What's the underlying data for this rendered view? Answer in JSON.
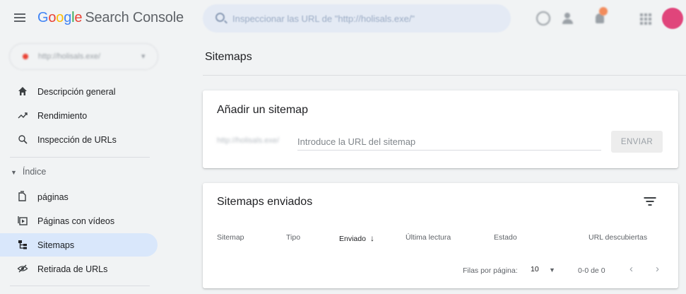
{
  "header": {
    "logo": [
      "G",
      "o",
      "o",
      "g",
      "l",
      "e"
    ],
    "product": "Search Console",
    "search_placeholder": "Inspeccionar las URL de \"http://holisals.exe/\""
  },
  "sidebar": {
    "property": "http://holisals.exe/",
    "items": [
      {
        "label": "Descripción general",
        "icon": "home-icon"
      },
      {
        "label": "Rendimiento",
        "icon": "trending-icon"
      },
      {
        "label": "Inspección de URLs",
        "icon": "search-icon"
      }
    ],
    "section": "Índice",
    "index_items": [
      {
        "label": "páginas",
        "icon": "pages-icon"
      },
      {
        "label": "Páginas con vídeos",
        "icon": "video-pages-icon"
      },
      {
        "label": "Sitemaps",
        "icon": "sitemap-icon",
        "active": true
      },
      {
        "label": "Retirada de URLs",
        "icon": "removals-icon"
      }
    ]
  },
  "main": {
    "title": "Sitemaps",
    "add_card": {
      "title": "Añadir un sitemap",
      "url_prefix": "http://holisals.exe/",
      "input_placeholder": "Introduce la URL del sitemap",
      "submit": "ENVIAR"
    },
    "sent_card": {
      "title": "Sitemaps enviados",
      "columns": [
        "Sitemap",
        "Tipo",
        "Enviado",
        "Última lectura",
        "Estado",
        "URL descubiertas"
      ],
      "sorted_column": "Enviado",
      "rows_per_page_label": "Filas por página:",
      "rows_per_page": "10",
      "range": "0-0 de 0"
    }
  },
  "colors": {
    "active_nav": "#d9e7fb",
    "background": "#f1f3f4",
    "accent_blue": "#4285f4"
  }
}
